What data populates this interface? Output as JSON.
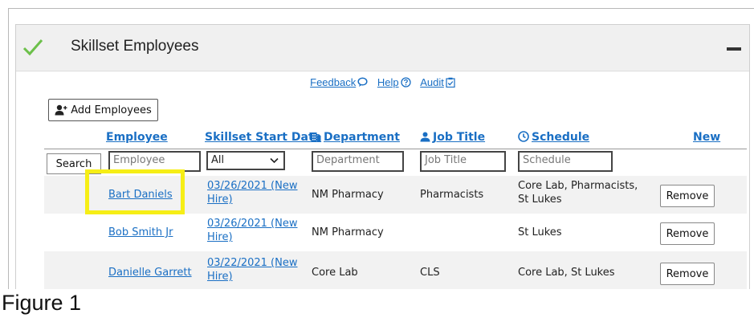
{
  "panel": {
    "title": "Skillset Employees"
  },
  "links": {
    "feedback": "Feedback",
    "help": "Help",
    "audit": "Audit"
  },
  "toolbar": {
    "add_employees": "Add Employees"
  },
  "columns": {
    "employee": "Employee",
    "start_date": "Skillset Start Date",
    "department": "Department",
    "job_title": "Job Title",
    "schedule": "Schedule",
    "new": "New"
  },
  "filters": {
    "search_label": "Search",
    "employee_placeholder": "Employee",
    "start_date_selected": "All",
    "department_placeholder": "Department",
    "job_title_placeholder": "Job Title",
    "schedule_placeholder": "Schedule"
  },
  "rows": [
    {
      "employee": "Bart Daniels",
      "start_date_line1": "03/26/2021 (New",
      "start_date_line2": "Hire)",
      "department": "NM Pharmacy",
      "job_title": "Pharmacists",
      "schedule_line1": "Core Lab, Pharmacists,",
      "schedule_line2": "St Lukes",
      "action": "Remove"
    },
    {
      "employee": "Bob Smith Jr",
      "start_date_line1": "03/26/2021 (New",
      "start_date_line2": "Hire)",
      "department": "NM Pharmacy",
      "job_title": "",
      "schedule_line1": "St Lukes",
      "schedule_line2": "",
      "action": "Remove"
    },
    {
      "employee": "Danielle Garrett",
      "start_date_line1": "03/22/2021 (New",
      "start_date_line2": "Hire)",
      "department": "Core Lab",
      "job_title": "CLS",
      "schedule_line1": "Core Lab, St Lukes",
      "schedule_line2": "",
      "action": "Remove"
    }
  ],
  "caption": "Figure 1",
  "colors": {
    "link": "#1a6fc4",
    "check": "#6cc04a",
    "highlight": "#f6ee16",
    "header_bg": "#f0f0f0"
  },
  "icons": {
    "status": "check-icon",
    "collapse": "minus-icon",
    "feedback": "speech-bubble-icon",
    "help": "question-circle-icon",
    "audit": "clipboard-check-icon",
    "add": "add-user-icon",
    "department": "building-icon",
    "job_title": "person-icon",
    "schedule": "clock-icon"
  }
}
